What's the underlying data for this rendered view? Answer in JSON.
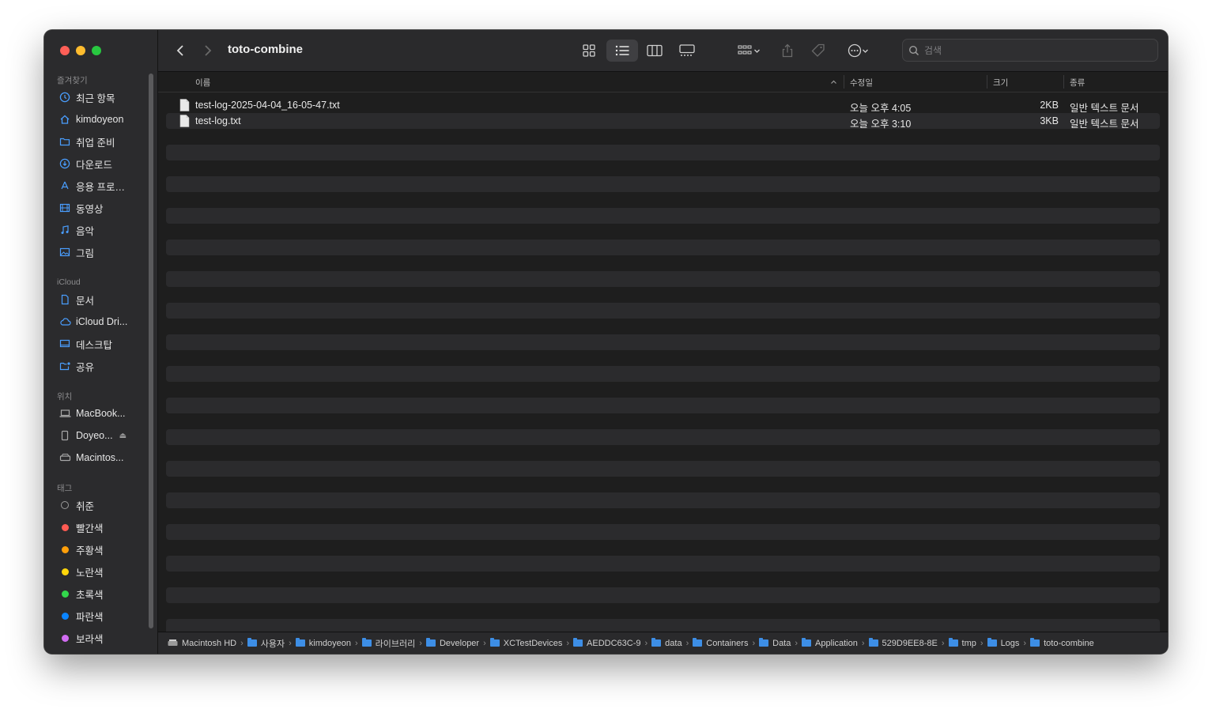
{
  "window": {
    "title": "toto-combine"
  },
  "sidebar": {
    "sections": [
      {
        "label": "즐겨찾기",
        "items": [
          {
            "label": "최근 항목",
            "icon": "clock-icon"
          },
          {
            "label": "kimdoyeon",
            "icon": "home-icon"
          },
          {
            "label": "취업 준비",
            "icon": "folder-icon"
          },
          {
            "label": "다운로드",
            "icon": "download-icon"
          },
          {
            "label": "응용 프로…",
            "icon": "apps-icon"
          },
          {
            "label": "동영상",
            "icon": "film-icon"
          },
          {
            "label": "음악",
            "icon": "music-icon"
          },
          {
            "label": "그림",
            "icon": "photo-icon"
          }
        ]
      },
      {
        "label": "iCloud",
        "items": [
          {
            "label": "문서",
            "icon": "document-icon"
          },
          {
            "label": "iCloud Dri...",
            "icon": "cloud-icon"
          },
          {
            "label": "데스크탑",
            "icon": "desktop-icon"
          },
          {
            "label": "공유",
            "icon": "shared-folder-icon"
          }
        ]
      },
      {
        "label": "위치",
        "items": [
          {
            "label": "MacBook...",
            "icon": "laptop-icon"
          },
          {
            "label": "Doyeo...",
            "icon": "external-drive-icon"
          },
          {
            "label": "Macintos...",
            "icon": "hard-drive-icon"
          }
        ]
      },
      {
        "label": "태그",
        "items": [
          {
            "label": "취준",
            "color": ""
          },
          {
            "label": "빨간색",
            "color": "#ff5a52"
          },
          {
            "label": "주황색",
            "color": "#ff9f0a"
          },
          {
            "label": "노란색",
            "color": "#ffd60a"
          },
          {
            "label": "초록색",
            "color": "#32d74b"
          },
          {
            "label": "파란색",
            "color": "#0a84ff"
          },
          {
            "label": "보라색",
            "color": "#d16cf2"
          }
        ]
      }
    ]
  },
  "toolbar": {
    "back_icon": "chevron-left-icon",
    "forward_icon": "chevron-right-icon",
    "view_icons": [
      "grid-view-icon",
      "list-view-icon",
      "column-view-icon",
      "gallery-view-icon"
    ],
    "active_view": "list-view-icon",
    "search_placeholder": "검색"
  },
  "columns": {
    "name": "이름",
    "modified": "수정일",
    "size": "크기",
    "kind": "종류"
  },
  "files": [
    {
      "name": "test-log-2025-04-04_16-05-47.txt",
      "modified": "오늘 오후 4:05",
      "size": "2KB",
      "kind": "일반 텍스트 문서"
    },
    {
      "name": "test-log.txt",
      "modified": "오늘 오후 3:10",
      "size": "3KB",
      "kind": "일반 텍스트 문서"
    }
  ],
  "pathbar": [
    "Macintosh HD",
    "사용자",
    "kimdoyeon",
    "라이브러리",
    "Developer",
    "XCTestDevices",
    "AEDDC63C-9",
    "data",
    "Containers",
    "Data",
    "Application",
    "529D9EE8-8E",
    "tmp",
    "Logs",
    "toto-combine"
  ]
}
